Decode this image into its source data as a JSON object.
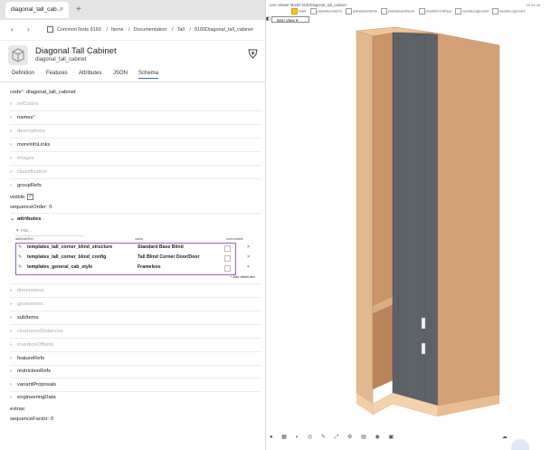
{
  "browser_tab": {
    "label": "diagonal_tall_cab...",
    "close": "×",
    "add": "+"
  },
  "breadcrumb": {
    "items": [
      "CommonTests 9160",
      "Items",
      "Documentation",
      "Tall",
      "9160Diagonal_tall_cabinet"
    ],
    "separator": "/"
  },
  "header": {
    "title": "Diagonal Tall Cabinet",
    "subtitle": "diagonal_tall_cabinet"
  },
  "tabs": [
    "Definition",
    "Features",
    "Attributes",
    "JSON",
    "Schema"
  ],
  "form": {
    "code_label": "code",
    "code_value": "diagonal_tall_cabinet",
    "refCodes": "refCodes",
    "names": "names",
    "descriptions": "descriptions",
    "moreInfoLinks": "moreInfoLinks",
    "images": "images",
    "classification": "classification",
    "groupRefs": "groupRefs",
    "visible": "visible:",
    "sequenceOrder": "sequenceOrder:",
    "sequenceOrder_value": "0",
    "attributes": "attributes"
  },
  "attributes": {
    "filter_placeholder": "Filte...",
    "columns": [
      "attributeRef",
      "value",
      "overridable"
    ],
    "rows": [
      {
        "name": "templates_tall_corner_blind_structure",
        "value": "Standard Base Blind"
      },
      {
        "name": "templates_tall_corner_blind_config",
        "value": "Tall Blind Corner Door/Door"
      },
      {
        "name": "templates_general_cab_style",
        "value": "Frameless"
      }
    ],
    "add_label": "+ Add attributes"
  },
  "form_bottom": {
    "dimensions": "dimensions",
    "geometries": "geometries",
    "subItems": "subItems",
    "clearanceDistances": "clearanceDistances",
    "insertionOffsets": "insertionOffsets",
    "featureRefs": "featureRefs",
    "restrictionRefs": "restrictionRefs",
    "variantProposals": "variantProposals",
    "engineeringData": "engineeringData",
    "extras": "extras:",
    "sequenceFactor": "sequenceFactor:",
    "sequenceFactor_value": "0"
  },
  "viewer": {
    "title": "Live Viewer Model 9160Diagonal_tall_cabinet",
    "time": "00:04:46",
    "options": [
      {
        "label": "mark",
        "on": true
      },
      {
        "label": "planeNormalsTo",
        "on": false
      },
      {
        "label": "planeBoundDim",
        "on": false
      },
      {
        "label": "planeBoundNode",
        "on": false
      },
      {
        "label": "doubleFrontFace",
        "on": false
      },
      {
        "label": "doubleLogicJoint",
        "on": false
      },
      {
        "label": "doubleLogicJoint",
        "on": false
      }
    ],
    "view_select": "Item View"
  },
  "colors": {
    "accent": "#3a6ea5",
    "highlight_box": "#9a59d6",
    "wood": "#d9a57a",
    "panel": "#5d6168"
  }
}
